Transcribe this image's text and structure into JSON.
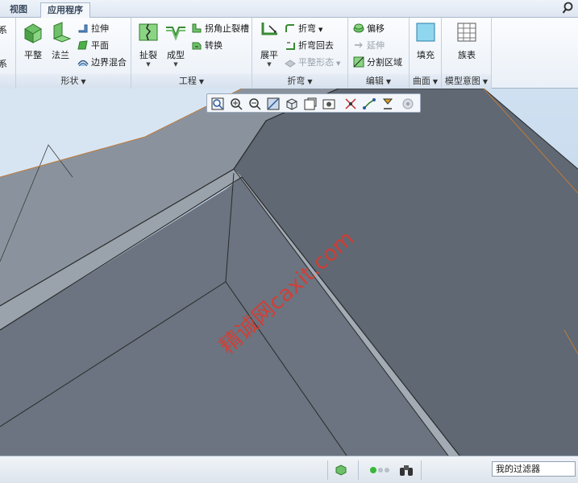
{
  "tabs": [
    {
      "label": "视图"
    },
    {
      "label": "应用程序"
    }
  ],
  "ribbon": {
    "edge_left_top": "系",
    "edge_left_bottom": "系",
    "shape_group": {
      "label": "形状",
      "flat": "平整",
      "flange": "法兰",
      "extrude": "拉伸",
      "planar": "平面",
      "boundary_blend": "边界混合"
    },
    "engineering_group": {
      "label": "工程",
      "rip": "扯裂",
      "form": "成型",
      "corner_relief": "拐角止裂槽",
      "convert": "转换"
    },
    "bend_group": {
      "label": "折弯",
      "unbend": "展平",
      "bend": "折弯",
      "bend_back": "折弯回去",
      "flat_pattern": "平整形态"
    },
    "edit_group": {
      "label": "编辑",
      "offset": "偏移",
      "extend": "延伸",
      "split_area": "分割区域"
    },
    "surface_group": {
      "label": "曲面",
      "fill": "填充"
    },
    "model_intent_group": {
      "label": "模型意图",
      "family_table": "族表"
    }
  },
  "watermark": "精诚网caxit.com",
  "statusbar": {
    "filter_value": "我的过滤器"
  },
  "colors": {
    "viewport_bg": "#c6d9ec",
    "part_face": "#6a7480",
    "part_face_dark": "#5b646f",
    "part_face_light": "#8a939d",
    "edge": "#222222",
    "watermark": "#e0382c"
  }
}
